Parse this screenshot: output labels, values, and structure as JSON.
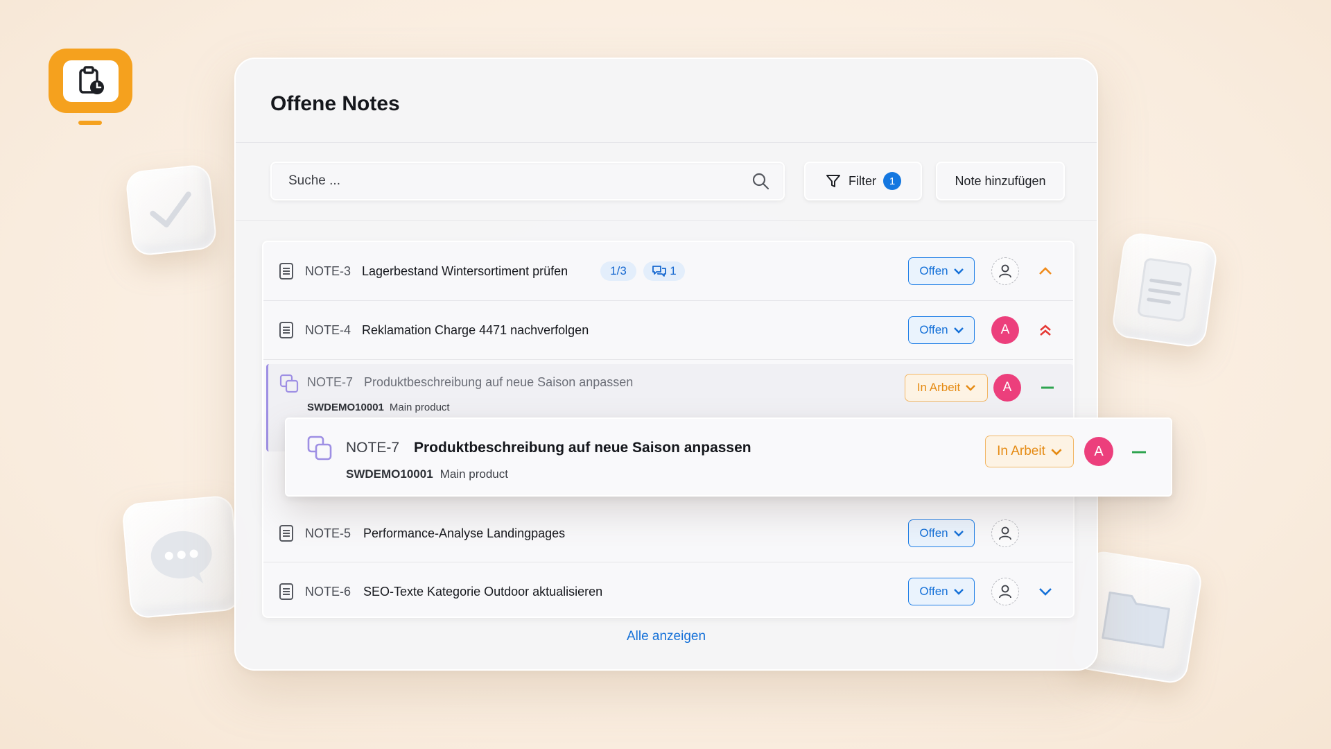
{
  "app": {
    "logo_icon": "clipboard-clock-icon",
    "accent": "#f5a11e"
  },
  "panel": {
    "title": "Offene Notes",
    "search_placeholder": "Suche ...",
    "filter": {
      "label": "Filter",
      "count": "1"
    },
    "add_label": "Note hinzufügen",
    "show_all": "Alle anzeigen"
  },
  "notes": [
    {
      "id": "NOTE-3",
      "title": "Lagerbestand Wintersortiment prüfen",
      "progress": "1/3",
      "comments": "1",
      "status": "Offen",
      "assignee": "",
      "priority": "high-chevron-up-icon"
    },
    {
      "id": "NOTE-4",
      "title": "Reklamation Charge 4471 nachverfolgen",
      "status": "Offen",
      "assignee": "A",
      "priority": "highest-double-chevron-up-icon"
    },
    {
      "id": "NOTE-7",
      "title": "Produktbeschreibung auf neue Saison anpassen",
      "code": "SWDEMO10001",
      "product": "Main product",
      "status": "In Arbeit",
      "assignee": "A",
      "priority": "medium-dash-icon"
    },
    {
      "id": "NOTE-5",
      "title": "Performance-Analyse Landingpages",
      "status": "Offen",
      "assignee": ""
    },
    {
      "id": "NOTE-6",
      "title": "SEO-Texte Kategorie Outdoor aktualisieren",
      "status": "Offen",
      "assignee": "",
      "priority": "low-chevron-down-icon"
    }
  ],
  "dragged": {
    "id": "NOTE-7",
    "title": "Produktbeschreibung auf neue Saison anpassen",
    "code": "SWDEMO10001",
    "product": "Main product",
    "status": "In Arbeit",
    "assignee": "A"
  }
}
